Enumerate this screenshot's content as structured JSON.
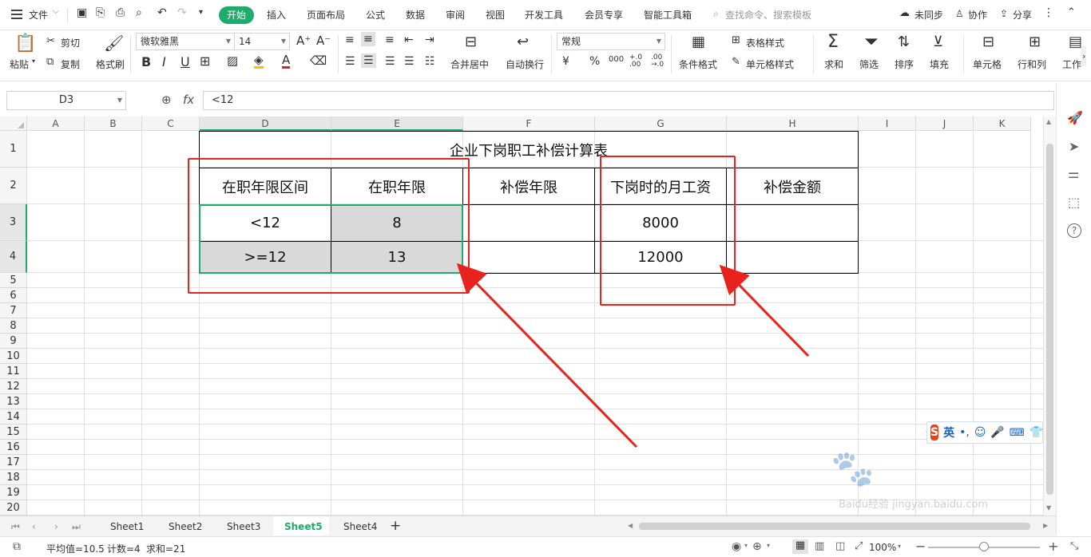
{
  "menu": {
    "file_label": "文件",
    "tabs": [
      "开始",
      "插入",
      "页面布局",
      "公式",
      "数据",
      "审阅",
      "视图",
      "开发工具",
      "会员专享",
      "智能工具箱"
    ],
    "search_placeholder": "查找命令、搜索模板",
    "sync_label": "未同步",
    "collab_label": "协作",
    "share_label": "分享"
  },
  "ribbon": {
    "paste": "粘贴",
    "cut": "剪切",
    "copy": "复制",
    "format_painter": "格式刷",
    "font_name": "微软雅黑",
    "font_size": "14",
    "merge_center": "合并居中",
    "wrap_text": "自动换行",
    "number_format": "常规",
    "cond_format": "条件格式",
    "table_style": "表格样式",
    "cell_style": "单元格样式",
    "sum": "求和",
    "filter": "筛选",
    "sort": "排序",
    "fill": "填充",
    "cell": "单元格",
    "rows_cols": "行和列",
    "worksheet": "工作"
  },
  "formula_bar": {
    "name_box": "D3",
    "content": "<12"
  },
  "columns": [
    "A",
    "B",
    "C",
    "D",
    "E",
    "F",
    "G",
    "H",
    "I",
    "J",
    "K"
  ],
  "rows": [
    "1",
    "2",
    "3",
    "4",
    "5",
    "6",
    "7",
    "8",
    "9",
    "10",
    "11",
    "12",
    "13",
    "14",
    "15",
    "16",
    "17",
    "18",
    "19",
    "20"
  ],
  "table": {
    "title": "企业下岗职工补偿计算表",
    "headers": [
      "在职年限区间",
      "在职年限",
      "补偿年限",
      "下岗时的月工资",
      "补偿金额"
    ],
    "row3": [
      "<12",
      "8",
      "",
      "8000",
      ""
    ],
    "row4": [
      ">=12",
      "13",
      "",
      "12000",
      ""
    ]
  },
  "sheets": [
    "Sheet1",
    "Sheet2",
    "Sheet3",
    "Sheet5",
    "Sheet4"
  ],
  "active_sheet": "Sheet5",
  "status": {
    "average": "平均值=10.5",
    "count": "计数=4",
    "sum": "求和=21",
    "zoom": "100%"
  },
  "ime": {
    "lang": "英"
  },
  "watermark": "Baidu经验 jingyan.baidu.com",
  "colors": {
    "accent_green": "#1fab6b",
    "annotation_red": "#e8221c",
    "selected_fill": "#d9d9d9"
  }
}
